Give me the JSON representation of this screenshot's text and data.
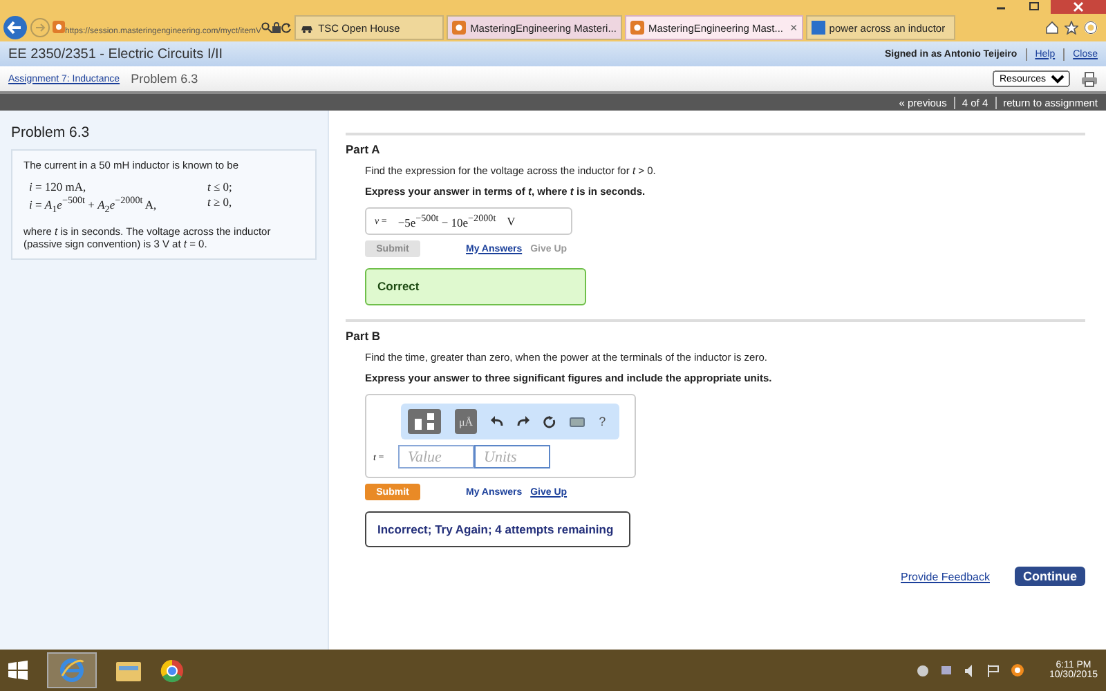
{
  "browser": {
    "url": "https://session.masteringengineering.com/myct/itemV",
    "tabs": [
      {
        "label": "TSC Open House",
        "selected": false,
        "closable": false
      },
      {
        "label": "MasteringEngineering Masteri...",
        "selected": false,
        "closable": false
      },
      {
        "label": "MasteringEngineering Mast...",
        "selected": true,
        "closable": true
      },
      {
        "label": "power across an inductor",
        "selected": false,
        "closable": false
      }
    ],
    "close_glyph": "×"
  },
  "header": {
    "course": "EE 2350/2351 - Electric Circuits I/II",
    "signed_in": "Signed in as Antonio Teijeiro",
    "links": [
      "Help",
      "Close"
    ]
  },
  "breadcrumb": {
    "assignment": "Assignment 7: Inductance",
    "current": "Problem 6.3",
    "resources": "Resources"
  },
  "nav": {
    "previous": "« previous",
    "position": "4 of 4",
    "return": "return to assignment"
  },
  "problem": {
    "title": "Problem 6.3",
    "intro": "The current in a 50 mH inductor is known to be",
    "equations": [
      {
        "expression": "*i* = 120 mA,",
        "condition": "*t* ≤ 0;"
      },
      {
        "expression": "*i* = *A*$_{1}$*e*$^{−500t}$ + *A*$_{2}$*e*$^{−2000t}$ A,",
        "condition": "*t* ≥ 0,"
      }
    ],
    "closing": "where *t* is in seconds. The voltage across the inductor (passive sign convention) is 3 V at *t* = 0."
  },
  "parts": [
    {
      "kind": "answered",
      "title": "Part A",
      "prompt": "Find the expression for the voltage across the inductor for *t* > 0.",
      "instruction": "Express your answer in terms of *t*, where *t* is in seconds.",
      "answer_label": "*v* =",
      "answer": "−5e$^{−500t}$ − 10e$^{−2000t}$",
      "unit": "V",
      "submit": "Submit",
      "submit_disabled": true,
      "my_answers": "My Answers",
      "my_answers_underlined": true,
      "give_up": "Give Up",
      "give_up_disabled": true,
      "feedback": {
        "kind": "correct",
        "text": "Correct"
      }
    },
    {
      "kind": "input",
      "title": "Part B",
      "prompt": "Find the time, greater than zero, when the power at the terminals of the inductor is zero.",
      "instruction": "Express your answer to three significant figures and include the appropriate units.",
      "toolbar": {
        "units_label": "μÅ",
        "help": "?"
      },
      "answer_label": "*t* =",
      "value_placeholder": "Value",
      "units_placeholder": "Units",
      "submit": "Submit",
      "submit_disabled": false,
      "my_answers": "My Answers",
      "my_answers_underlined": false,
      "give_up": "Give Up",
      "give_up_disabled": false,
      "feedback": {
        "kind": "incorrect",
        "text": "Incorrect; Try Again; 4 attempts remaining"
      }
    }
  ],
  "footer": {
    "feedback_link": "Provide Feedback",
    "continue": "Continue"
  },
  "taskbar": {
    "time": "6:11 PM",
    "date": "10/30/2015"
  }
}
